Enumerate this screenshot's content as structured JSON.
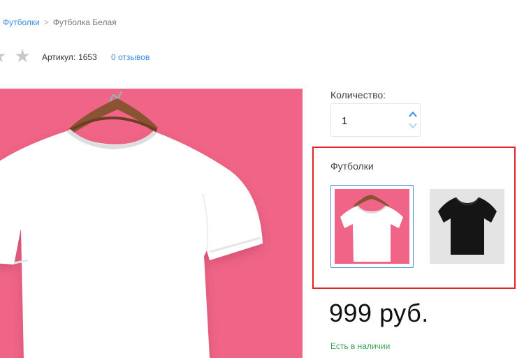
{
  "breadcrumb": {
    "parent": "Футболки",
    "separator": ">",
    "current": "Футболка Белая"
  },
  "rating": {
    "stars": "★ ★",
    "sku_label": "Артикул:",
    "sku_value": "1653",
    "reviews_link": "0 отзывов"
  },
  "quantity": {
    "label": "Количество:",
    "value": "1"
  },
  "variants": {
    "title": "Футболки",
    "items": [
      {
        "name": "white-tshirt",
        "selected": true
      },
      {
        "name": "black-tshirt",
        "selected": false
      }
    ]
  },
  "price": "999 руб.",
  "stock": "Есть в наличии",
  "colors": {
    "link": "#3a8ee6",
    "accent_pink": "#f06587",
    "highlight_border": "#e32222",
    "selected_border": "#4a90e2",
    "in_stock": "#3aa55a"
  }
}
